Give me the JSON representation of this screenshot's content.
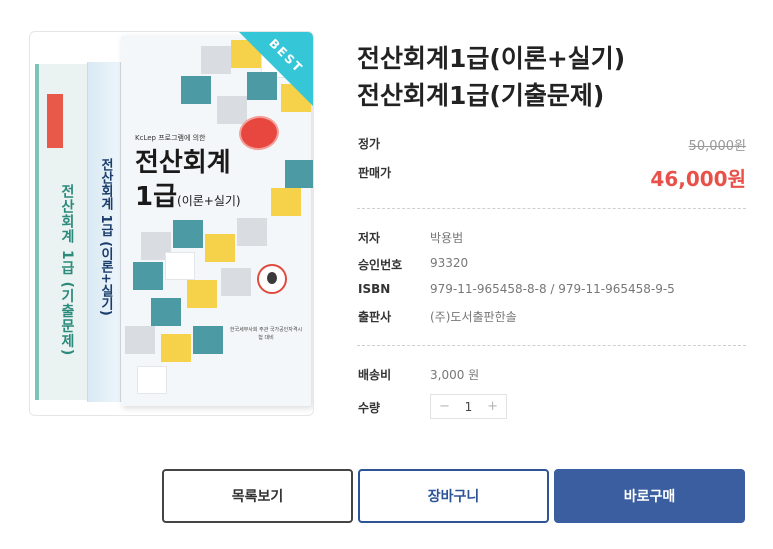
{
  "product": {
    "title_line1": "전산회계1급(이론+실기)",
    "title_line2": "전산회계1급(기출문제)"
  },
  "price": {
    "list_label": "정가",
    "list_value": "50,000원",
    "sale_label": "판매가",
    "sale_value": "46,000원",
    "sale_color": "#e8514a"
  },
  "details": [
    {
      "label": "저자",
      "value": "박용범"
    },
    {
      "label": "승인번호",
      "value": "93320"
    },
    {
      "label": "ISBN",
      "value": "979-11-965458-8-8 / 979-11-965458-9-5"
    },
    {
      "label": "출판사",
      "value": "(주)도서출판한솔"
    }
  ],
  "shipping": {
    "label": "배송비",
    "value": "3,000 원"
  },
  "quantity": {
    "label": "수량",
    "value": "1",
    "minus_icon": "minus-icon",
    "plus_icon": "plus-icon"
  },
  "cover": {
    "badge": "BEST",
    "publisher_line": "KcLep 프로그램에 의한",
    "title_main": "전산회계",
    "title_grade": "1급",
    "title_sub": "(이론+실기)",
    "desc": "한국세무사회 주관 국가공인자격시험 대비",
    "spine_text": "전산회계 1급 (이론+실기)",
    "back_text": "전산회계 1급 (기출문제)",
    "badge_color": "#35c6d8"
  },
  "actions": {
    "list": "목록보기",
    "cart": "장바구니",
    "buy": "바로구매",
    "buy_color": "#3a5ea0"
  }
}
